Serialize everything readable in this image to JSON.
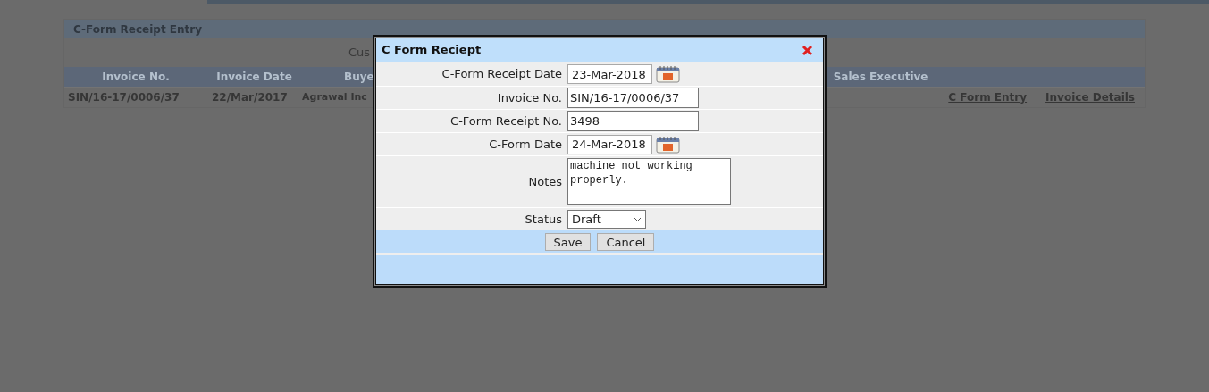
{
  "page": {
    "title": "C-Form Receipt Entry",
    "customer_label": "Cus",
    "table": {
      "columns": [
        "Invoice No.",
        "Invoice Date",
        "Buye",
        "Sales Executive"
      ],
      "rows": [
        {
          "cells": [
            "SIN/16-17/0006/37",
            "22/Mar/2017",
            "Agrawal Inc"
          ],
          "links": [
            "C Form Entry",
            "Invoice Details"
          ]
        }
      ]
    }
  },
  "dialog": {
    "title": "C Form Reciept",
    "fields": [
      {
        "kind": "date",
        "label": "C-Form Receipt Date",
        "value": "23-Mar-2018"
      },
      {
        "kind": "text",
        "label": "Invoice No.",
        "value": "SIN/16-17/0006/37"
      },
      {
        "kind": "text",
        "label": "C-Form Receipt No.",
        "value": "3498"
      },
      {
        "kind": "date",
        "label": "C-Form Date",
        "value": "24-Mar-2018"
      },
      {
        "kind": "textarea",
        "label": "Notes",
        "value": "machine not working\nproperly."
      },
      {
        "kind": "select",
        "label": "Status",
        "value": "Draft"
      }
    ],
    "buttons": [
      "Save",
      "Cancel"
    ]
  }
}
